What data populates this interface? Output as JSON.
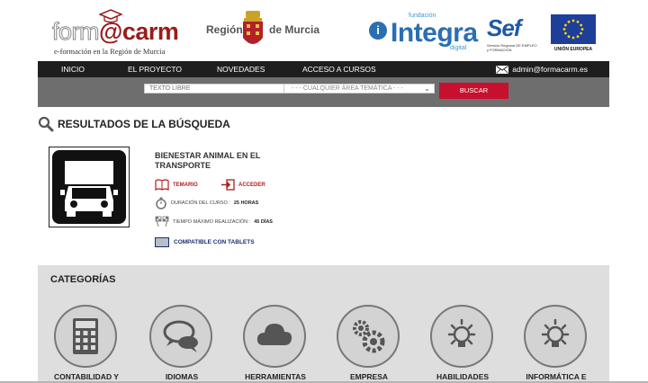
{
  "header": {
    "logo_forma": "form",
    "logo_at": "@",
    "logo_carm": "carm",
    "logo_subtitle": "e-formación en la Región de Murcia",
    "region_left": "Región",
    "region_right": "de Murcia",
    "integra_fundacion": "fundación",
    "integra_name": "Integra",
    "integra_digital": "digital",
    "sef_name": "Sef",
    "sef_subtitle": "Servicio Regional DE EMPLEO y FORMACIÓN",
    "eu_label": "UNIÓN EUROPEA"
  },
  "nav": {
    "items": [
      "INICIO",
      "EL PROYECTO",
      "NOVEDADES",
      "ACCESO A CURSOS"
    ],
    "email": "admin@formacarm.es"
  },
  "search": {
    "text_placeholder": "TEXTO LIBRE",
    "area_selected": "- - - CUALQUIER ÁREA TEMÁTICA - - -",
    "button_label": "BUSCAR"
  },
  "results": {
    "title": "RESULTADOS DE LA BÚSQUEDA",
    "course": {
      "title": "BIENESTAR ANIMAL EN EL TRANSPORTE",
      "temario_label": "TEMARIO",
      "acceder_label": "ACCEDER",
      "duration_label": "DURACIÓN DEL CURSO :",
      "duration_value": "25 HORAS",
      "max_time_label": "TIEMPO MÁXIMO REALIZACIÓN :",
      "max_time_value": "45 DÍAS",
      "tablet_label": "COMPATIBLE CON TABLETS"
    }
  },
  "categories": {
    "title": "CATEGORÍAS",
    "items": [
      {
        "label": "CONTABILIDAD Y",
        "icon": "calculator-icon"
      },
      {
        "label": "IDIOMAS",
        "icon": "speech-bubbles-icon"
      },
      {
        "label": "HERRAMIENTAS",
        "icon": "cloud-icon"
      },
      {
        "label": "EMPRESA",
        "icon": "gears-icon"
      },
      {
        "label": "HABILIDADES",
        "icon": "lightbulb-icon"
      },
      {
        "label": "INFORMÁTICA E",
        "icon": "lightbulb-icon"
      }
    ]
  },
  "colors": {
    "brand_red": "#9b1b1b",
    "button_red": "#c8102e",
    "nav_bg": "#1e1e1e",
    "search_bg": "#6e6e6e",
    "categories_bg": "#dedede",
    "integra_blue": "#2a6fb2"
  }
}
